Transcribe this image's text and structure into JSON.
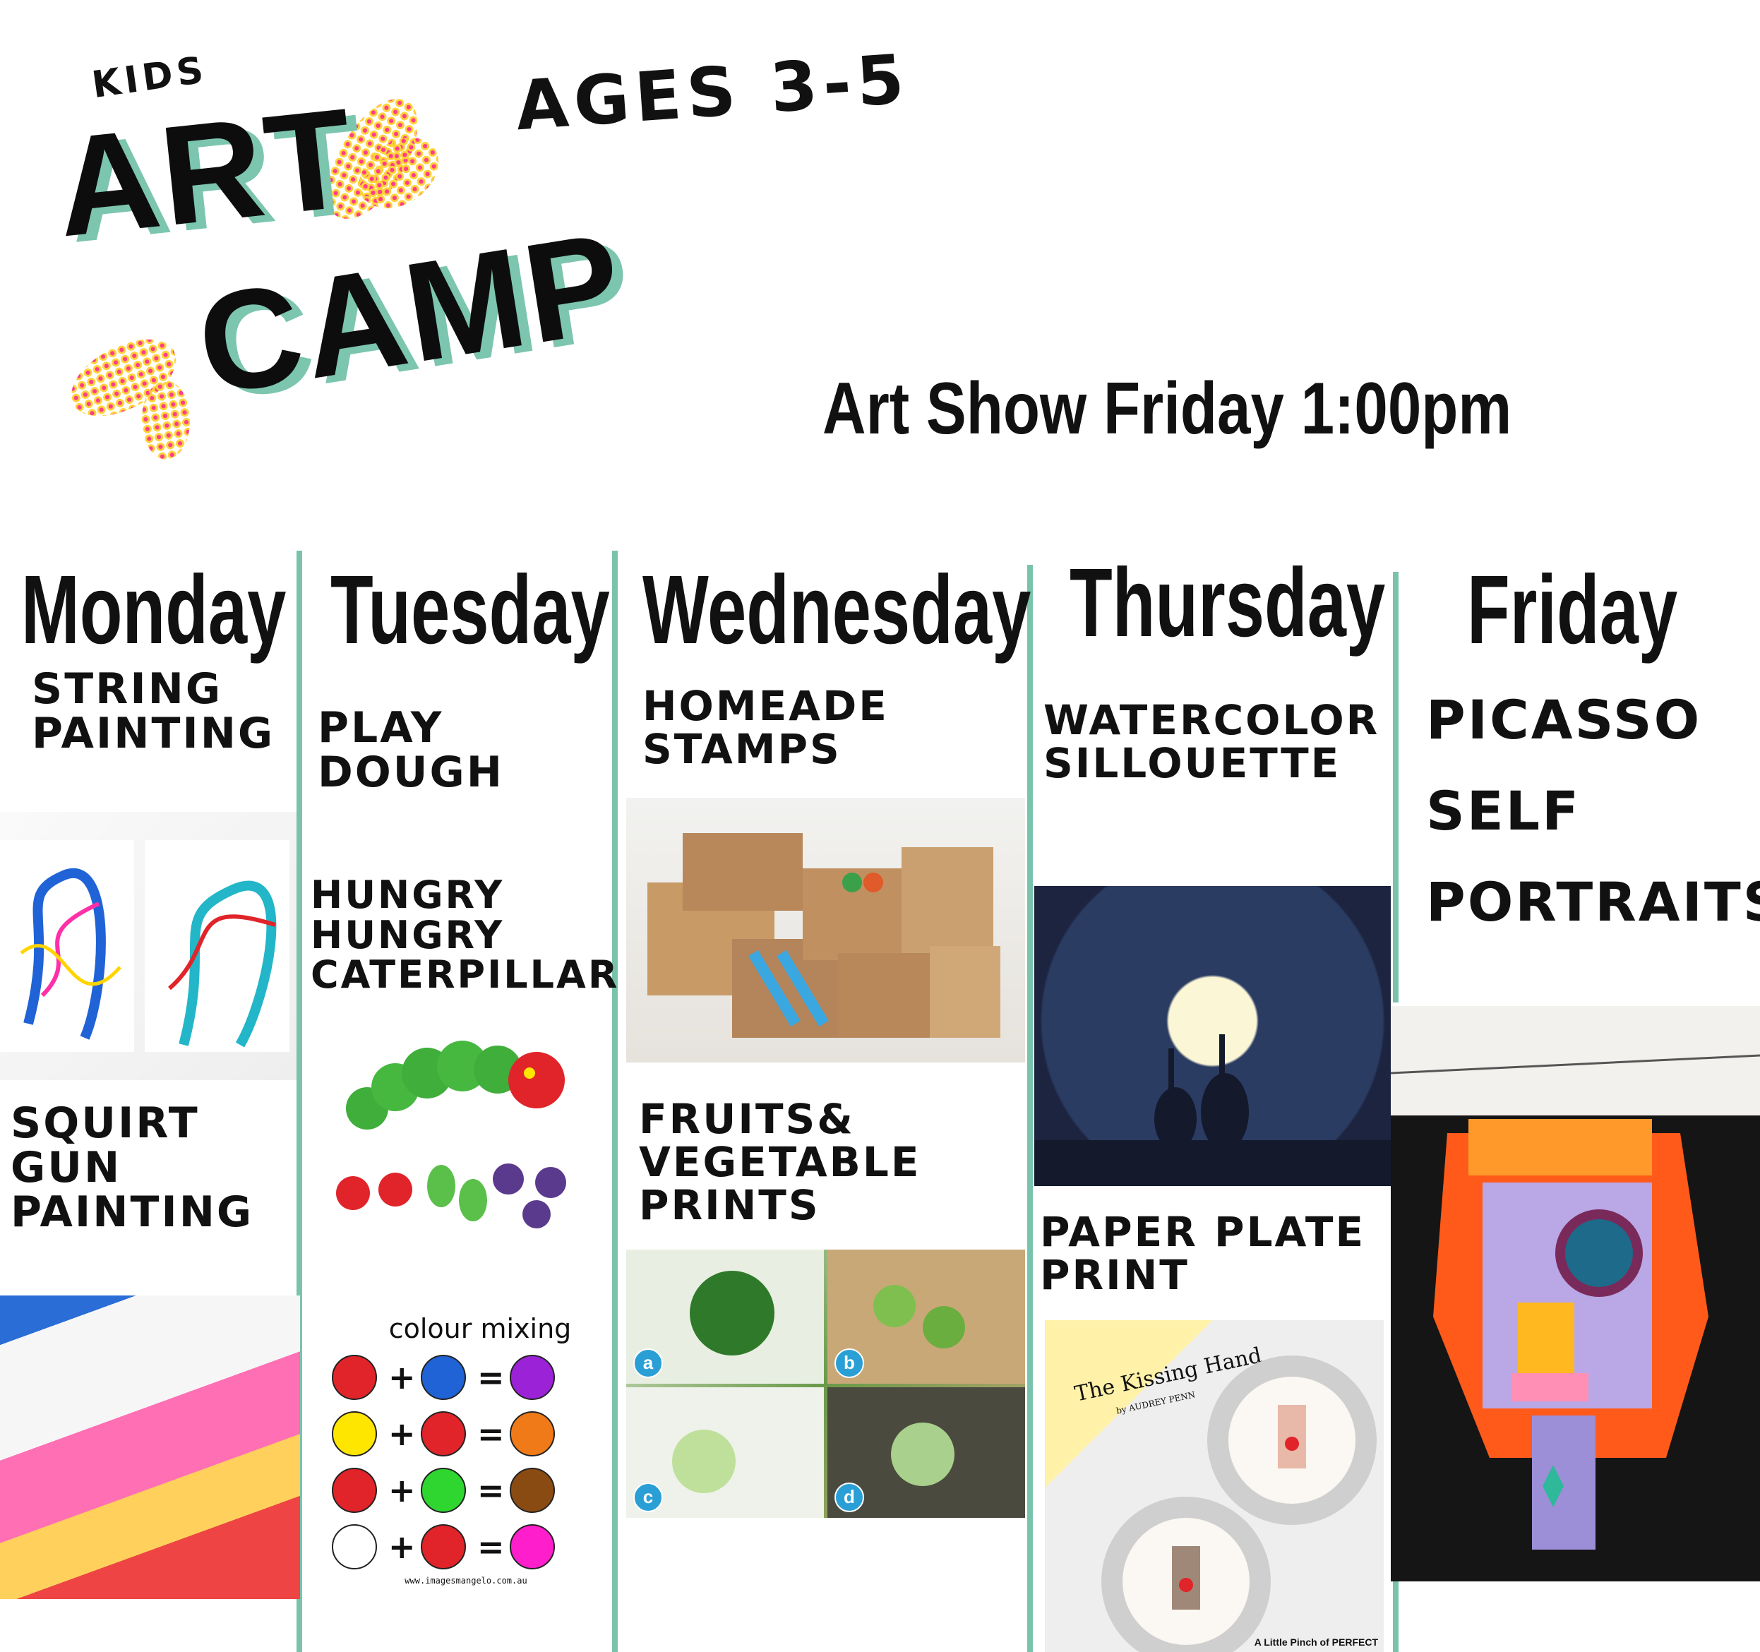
{
  "header": {
    "logo_kids": "KIDS",
    "logo_art": "ART",
    "logo_camp": "CAMP",
    "ages": "AGES 3-5",
    "art_show": "Art Show Friday 1:00pm"
  },
  "days": [
    {
      "name": "Monday",
      "activities": [
        "STRING\nPAINTING",
        "SQUIRT\nGUN\nPAINTING"
      ]
    },
    {
      "name": "Tuesday",
      "activities": [
        "PLAY\nDOUGH",
        "HUNGRY\nHUNGRY\nCATERPILLAR"
      ]
    },
    {
      "name": "Wednesday",
      "activities": [
        "HOMEADE\nSTAMPS",
        "FRUITS&\nVEGETABLE\nPRINTS"
      ]
    },
    {
      "name": "Thursday",
      "activities": [
        "WATERCOLOR\nSILLOUETTE",
        "PAPER PLATE\nPRINT"
      ]
    },
    {
      "name": "Friday",
      "activities": [
        "PICASSO\nSELF\nPORTRAITS"
      ]
    }
  ],
  "colour_mixing": {
    "title": "colour mixing",
    "rows": [
      {
        "a": "#e0242a",
        "b": "#1f63d6",
        "result": "#9b22d6"
      },
      {
        "a": "#ffe600",
        "b": "#e0242a",
        "result": "#f07a17"
      },
      {
        "a": "#e0242a",
        "b": "#2fd62f",
        "result": "#8a4b12"
      },
      {
        "a": "#ffffff",
        "b": "#e0242a",
        "result": "#ff1ecb"
      }
    ],
    "plus": "+",
    "equals": "=",
    "credit": "www.imagesmangelo.com.au"
  },
  "veg_labels": [
    "a",
    "b",
    "c",
    "d"
  ],
  "book_title": "The Kissing Hand",
  "book_author": "by AUDREY PENN",
  "plate_credit": "A Little Pinch of PERFECT",
  "accent": "#79c3ac"
}
